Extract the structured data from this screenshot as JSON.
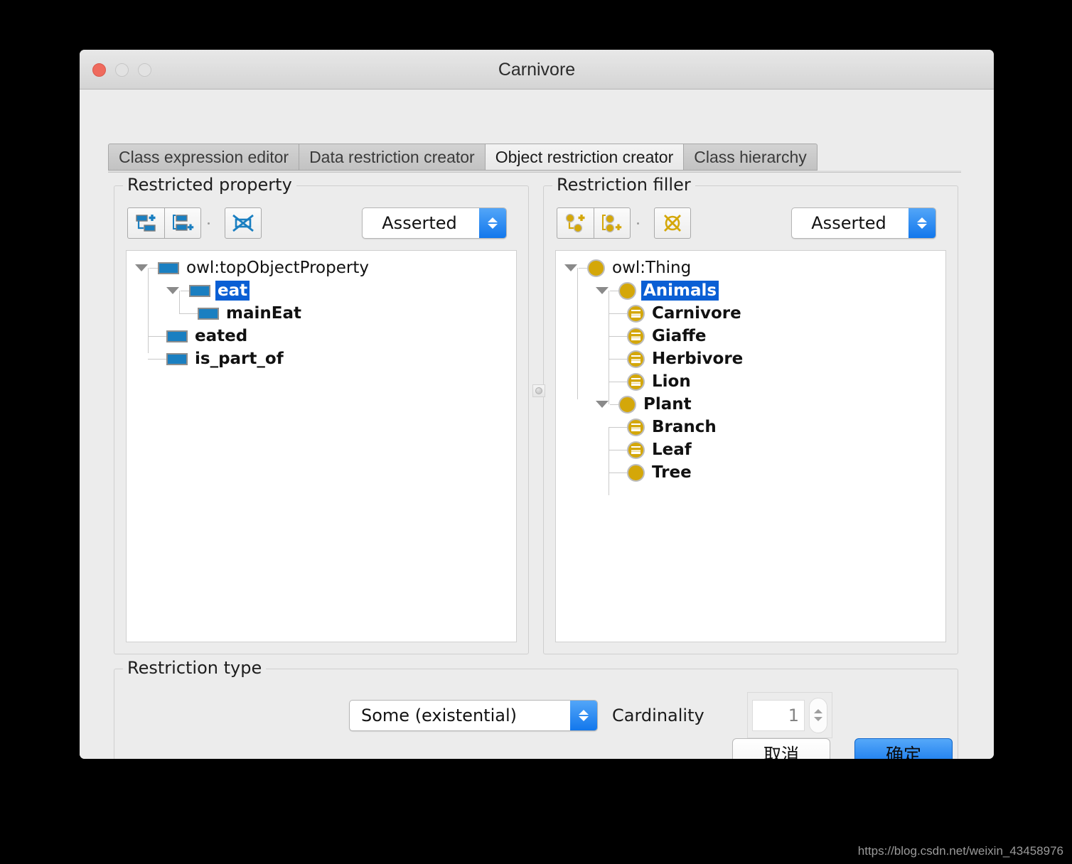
{
  "window": {
    "title": "Carnivore",
    "controls": [
      "close-button",
      "minimize-button",
      "maximize-button"
    ]
  },
  "tabs": [
    {
      "label": "Class expression editor",
      "selected": false
    },
    {
      "label": "Data restriction creator",
      "selected": false
    },
    {
      "label": "Object restriction creator",
      "selected": true
    },
    {
      "label": "Class hierarchy",
      "selected": false
    }
  ],
  "restricted_property": {
    "title": "Restricted property",
    "toolbar": [
      {
        "name": "add-sub-property-button",
        "icon": "add-sub-property-icon"
      },
      {
        "name": "add-sibling-property-button",
        "icon": "add-sibling-property-icon"
      },
      {
        "name": "delete-property-button",
        "icon": "delete-property-icon"
      }
    ],
    "mode_combo": {
      "value": "Asserted"
    },
    "tree": [
      {
        "label": "owl:topObjectProperty",
        "depth": 0,
        "bold": false,
        "selected": false,
        "expanded": true,
        "icon": "object-property-icon"
      },
      {
        "label": "eat",
        "depth": 1,
        "bold": true,
        "selected": true,
        "expanded": true,
        "icon": "object-property-icon"
      },
      {
        "label": "mainEat",
        "depth": 2,
        "bold": true,
        "selected": false,
        "expanded": false,
        "icon": "object-property-icon"
      },
      {
        "label": "eated",
        "depth": 1,
        "bold": true,
        "selected": false,
        "expanded": false,
        "icon": "object-property-icon"
      },
      {
        "label": "is_part_of",
        "depth": 1,
        "bold": true,
        "selected": false,
        "expanded": false,
        "icon": "object-property-icon"
      }
    ]
  },
  "restriction_filler": {
    "title": "Restriction filler",
    "toolbar": [
      {
        "name": "add-subclass-button",
        "icon": "add-subclass-icon"
      },
      {
        "name": "add-sibling-class-button",
        "icon": "add-sibling-class-icon"
      },
      {
        "name": "delete-class-button",
        "icon": "delete-class-icon"
      }
    ],
    "mode_combo": {
      "value": "Asserted"
    },
    "tree": [
      {
        "label": "owl:Thing",
        "depth": 0,
        "bold": false,
        "selected": false,
        "expanded": true,
        "icon": "class-icon"
      },
      {
        "label": "Animals",
        "depth": 1,
        "bold": true,
        "selected": true,
        "expanded": true,
        "icon": "class-icon"
      },
      {
        "label": "Carnivore",
        "depth": 2,
        "bold": true,
        "selected": false,
        "expanded": false,
        "icon": "defined-class-icon"
      },
      {
        "label": "Giaffe",
        "depth": 2,
        "bold": true,
        "selected": false,
        "expanded": false,
        "icon": "defined-class-icon"
      },
      {
        "label": "Herbivore",
        "depth": 2,
        "bold": true,
        "selected": false,
        "expanded": false,
        "icon": "defined-class-icon"
      },
      {
        "label": "Lion",
        "depth": 2,
        "bold": true,
        "selected": false,
        "expanded": false,
        "icon": "defined-class-icon"
      },
      {
        "label": "Plant",
        "depth": 1,
        "bold": true,
        "selected": false,
        "expanded": true,
        "icon": "class-icon"
      },
      {
        "label": "Branch",
        "depth": 2,
        "bold": true,
        "selected": false,
        "expanded": false,
        "icon": "defined-class-icon"
      },
      {
        "label": "Leaf",
        "depth": 2,
        "bold": true,
        "selected": false,
        "expanded": false,
        "icon": "defined-class-icon"
      },
      {
        "label": "Tree",
        "depth": 2,
        "bold": true,
        "selected": false,
        "expanded": false,
        "icon": "class-icon"
      }
    ]
  },
  "restriction_type": {
    "title": "Restriction type",
    "type_combo": {
      "value": "Some (existential)"
    },
    "cardinality_label": "Cardinality",
    "cardinality_value": "1",
    "cardinality_enabled": false
  },
  "footer": {
    "cancel_label": "取消",
    "ok_label": "确定"
  },
  "watermark": "https://blog.csdn.net/weixin_43458976",
  "colors": {
    "accent_blue": "#0f73eb",
    "selection_blue": "#0a5fd4",
    "property_icon_blue": "#1a7fc1",
    "class_icon_gold": "#d4a709",
    "window_bg": "#ececec"
  }
}
